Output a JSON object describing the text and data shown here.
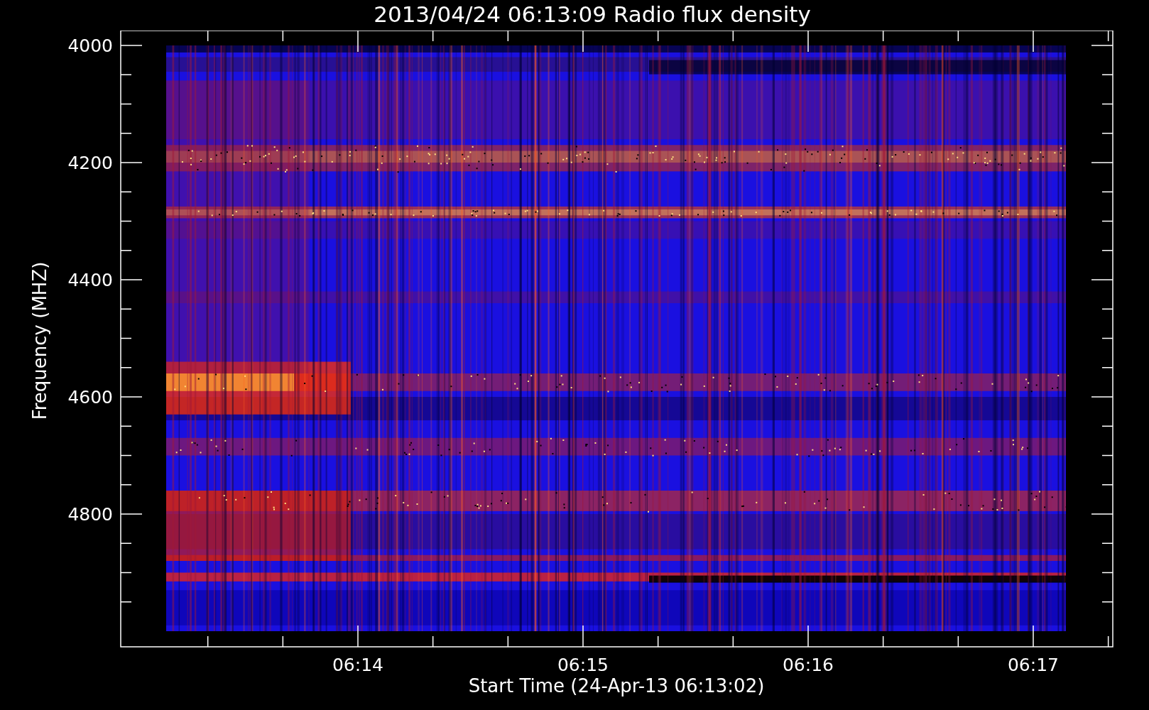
{
  "plot": {
    "title": "2013/04/24 06:13:09 Radio flux density",
    "ylabel": "Frequency (MHZ)",
    "xlabel": "Start Time (24-Apr-13 06:13:02)",
    "ytick_labels": [
      "4000",
      "4200",
      "4400",
      "4600",
      "4800"
    ],
    "xtick_labels": [
      "06:14",
      "06:15",
      "06:16",
      "06:17"
    ]
  }
}
